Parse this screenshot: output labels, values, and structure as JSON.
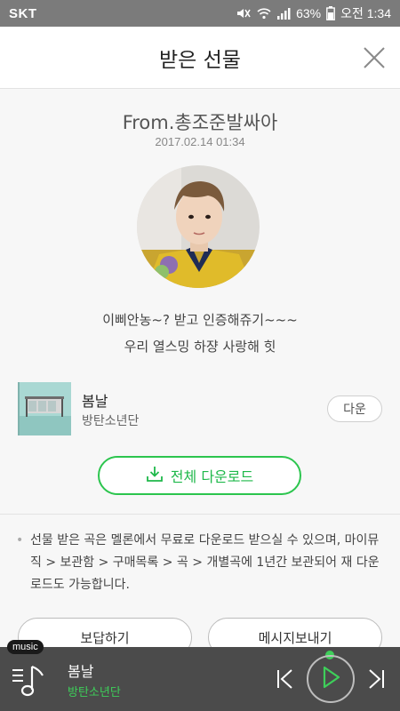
{
  "status_bar": {
    "carrier": "SKT",
    "battery": "63%",
    "time": "오전 1:34"
  },
  "header": {
    "title": "받은 선물"
  },
  "gift": {
    "from": "From.총조준발싸아",
    "date": "2017.02.14 01:34",
    "message_line1": "이삐안농~? 받고 인증해쥬기~~~",
    "message_line2": "우리 열스밍 하쟝 사랑해 힛"
  },
  "song": {
    "title": "봄날",
    "artist": "방탄소년단",
    "download_label": "다운"
  },
  "download_all_label": "전체 다운로드",
  "notice": {
    "bullet": "•",
    "text": "선물 받은 곡은 멜론에서 무료로 다운로드 받으실 수 있으며, 마이뮤직 > 보관함 > 구매목록 > 곡 > 개별곡에 1년간 보관되어 재 다운로드도 가능합니다."
  },
  "actions": {
    "reply_label": "보답하기",
    "message_label": "메시지보내기"
  },
  "player": {
    "tag": "music",
    "title": "봄날",
    "artist": "방탄소년단"
  },
  "colors": {
    "accent_green": "#2cc54e",
    "status_bar": "#7b7b7b",
    "player_bg": "#4b4b4b"
  }
}
